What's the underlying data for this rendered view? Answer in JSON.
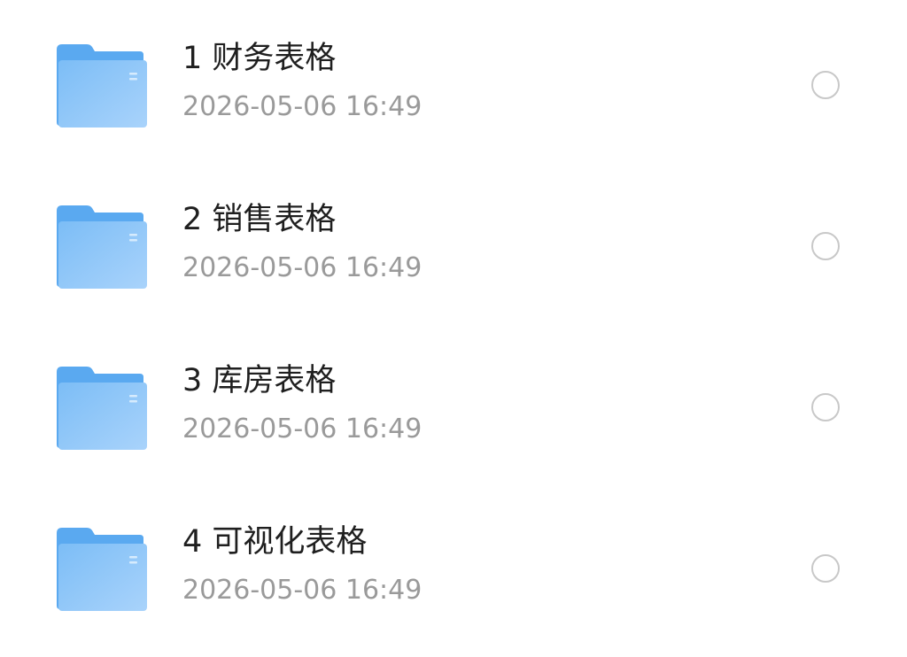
{
  "files": [
    {
      "name": "1 财务表格",
      "date": "2026-05-06 16:49",
      "icon": "folder-icon",
      "checked": false
    },
    {
      "name": "2 销售表格",
      "date": "2026-05-06 16:49",
      "icon": "folder-icon",
      "checked": false
    },
    {
      "name": "3 库房表格",
      "date": "2026-05-06 16:49",
      "icon": "folder-icon",
      "checked": false
    },
    {
      "name": "4 可视化表格",
      "date": "2026-05-06 16:49",
      "icon": "folder-icon",
      "checked": false
    }
  ],
  "colors": {
    "folder_back": "#5aa9f0",
    "folder_front_top": "#7cbdf6",
    "folder_front_bottom": "#a9d3fb",
    "title_text": "#1f1f1f",
    "meta_text": "#9a9a9a",
    "checkbox_border": "#c8c8c8"
  }
}
